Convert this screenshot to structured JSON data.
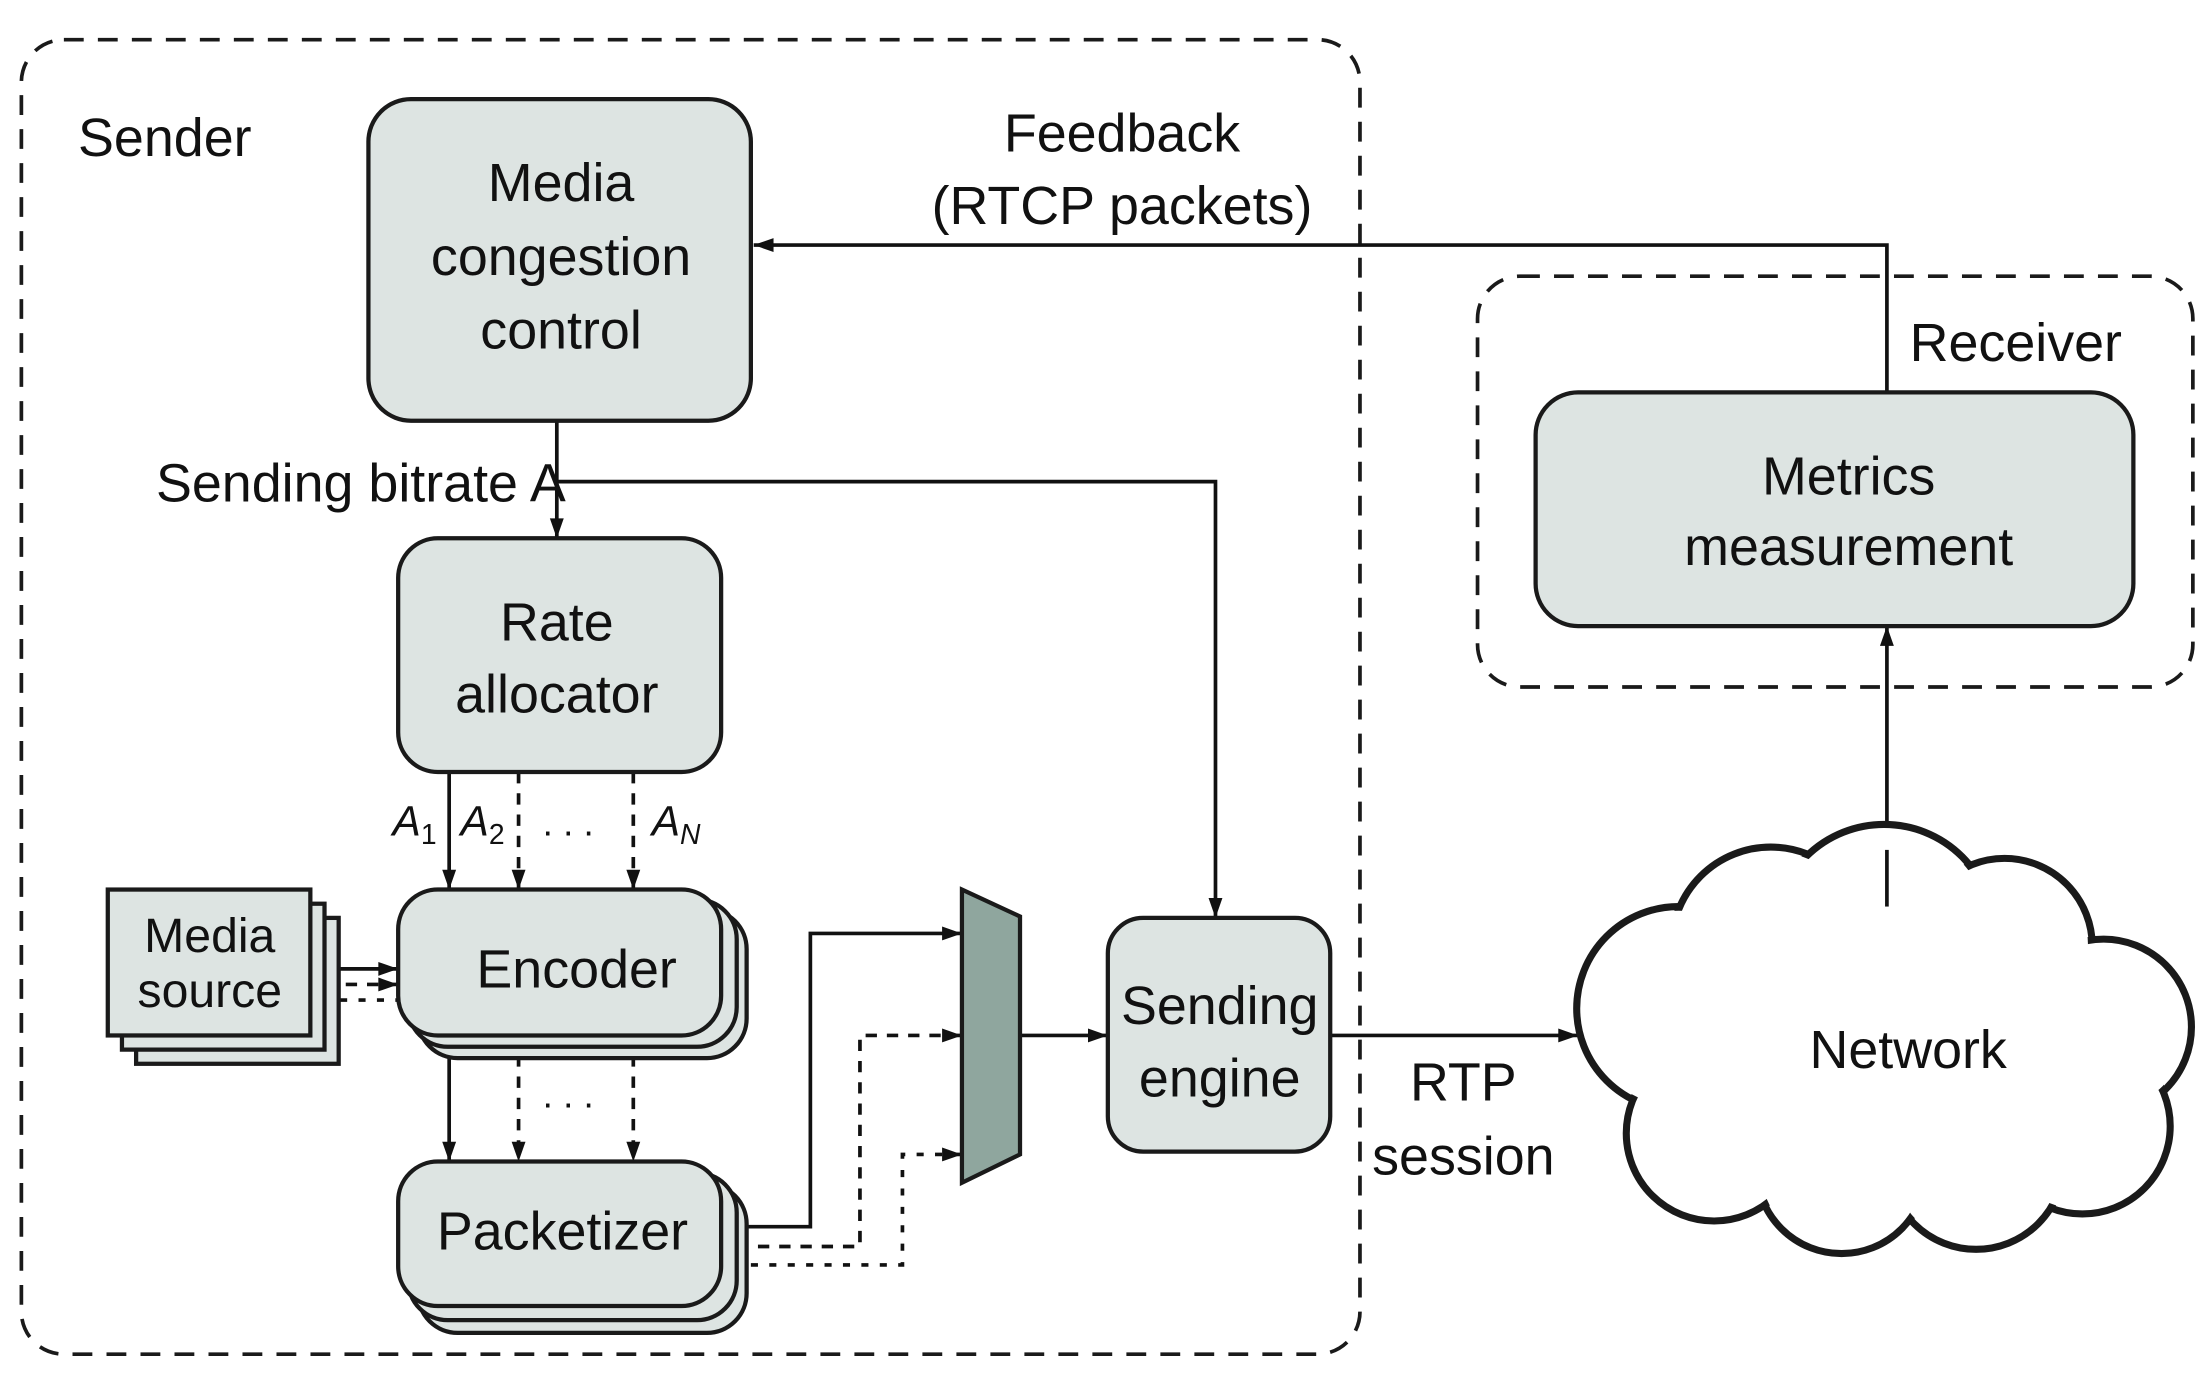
{
  "regions": {
    "sender": "Sender",
    "receiver": "Receiver"
  },
  "blocks": {
    "media_congestion_control": [
      "Media",
      "congestion",
      "control"
    ],
    "rate_allocator": [
      "Rate",
      "allocator"
    ],
    "encoder": "Encoder",
    "packetizer": "Packetizer",
    "media_source": [
      "Media",
      "source"
    ],
    "sending_engine": [
      "Sending",
      "engine"
    ],
    "metrics_measurement": [
      "Metrics",
      "measurement"
    ],
    "network": "Network"
  },
  "labels": {
    "feedback": [
      "Feedback",
      "(RTCP packets)"
    ],
    "sending_bitrate": "Sending bitrate A",
    "a1": {
      "base": "A",
      "sub": "1"
    },
    "a2": {
      "base": "A",
      "sub": "2"
    },
    "an": {
      "base": "A",
      "sub": "N"
    },
    "ellipsis": ". . .",
    "rtp_session": [
      "RTP",
      "session"
    ]
  },
  "colors": {
    "block_fill": "#dde4e2",
    "mux_fill": "#8fa69e",
    "line": "#111111"
  }
}
